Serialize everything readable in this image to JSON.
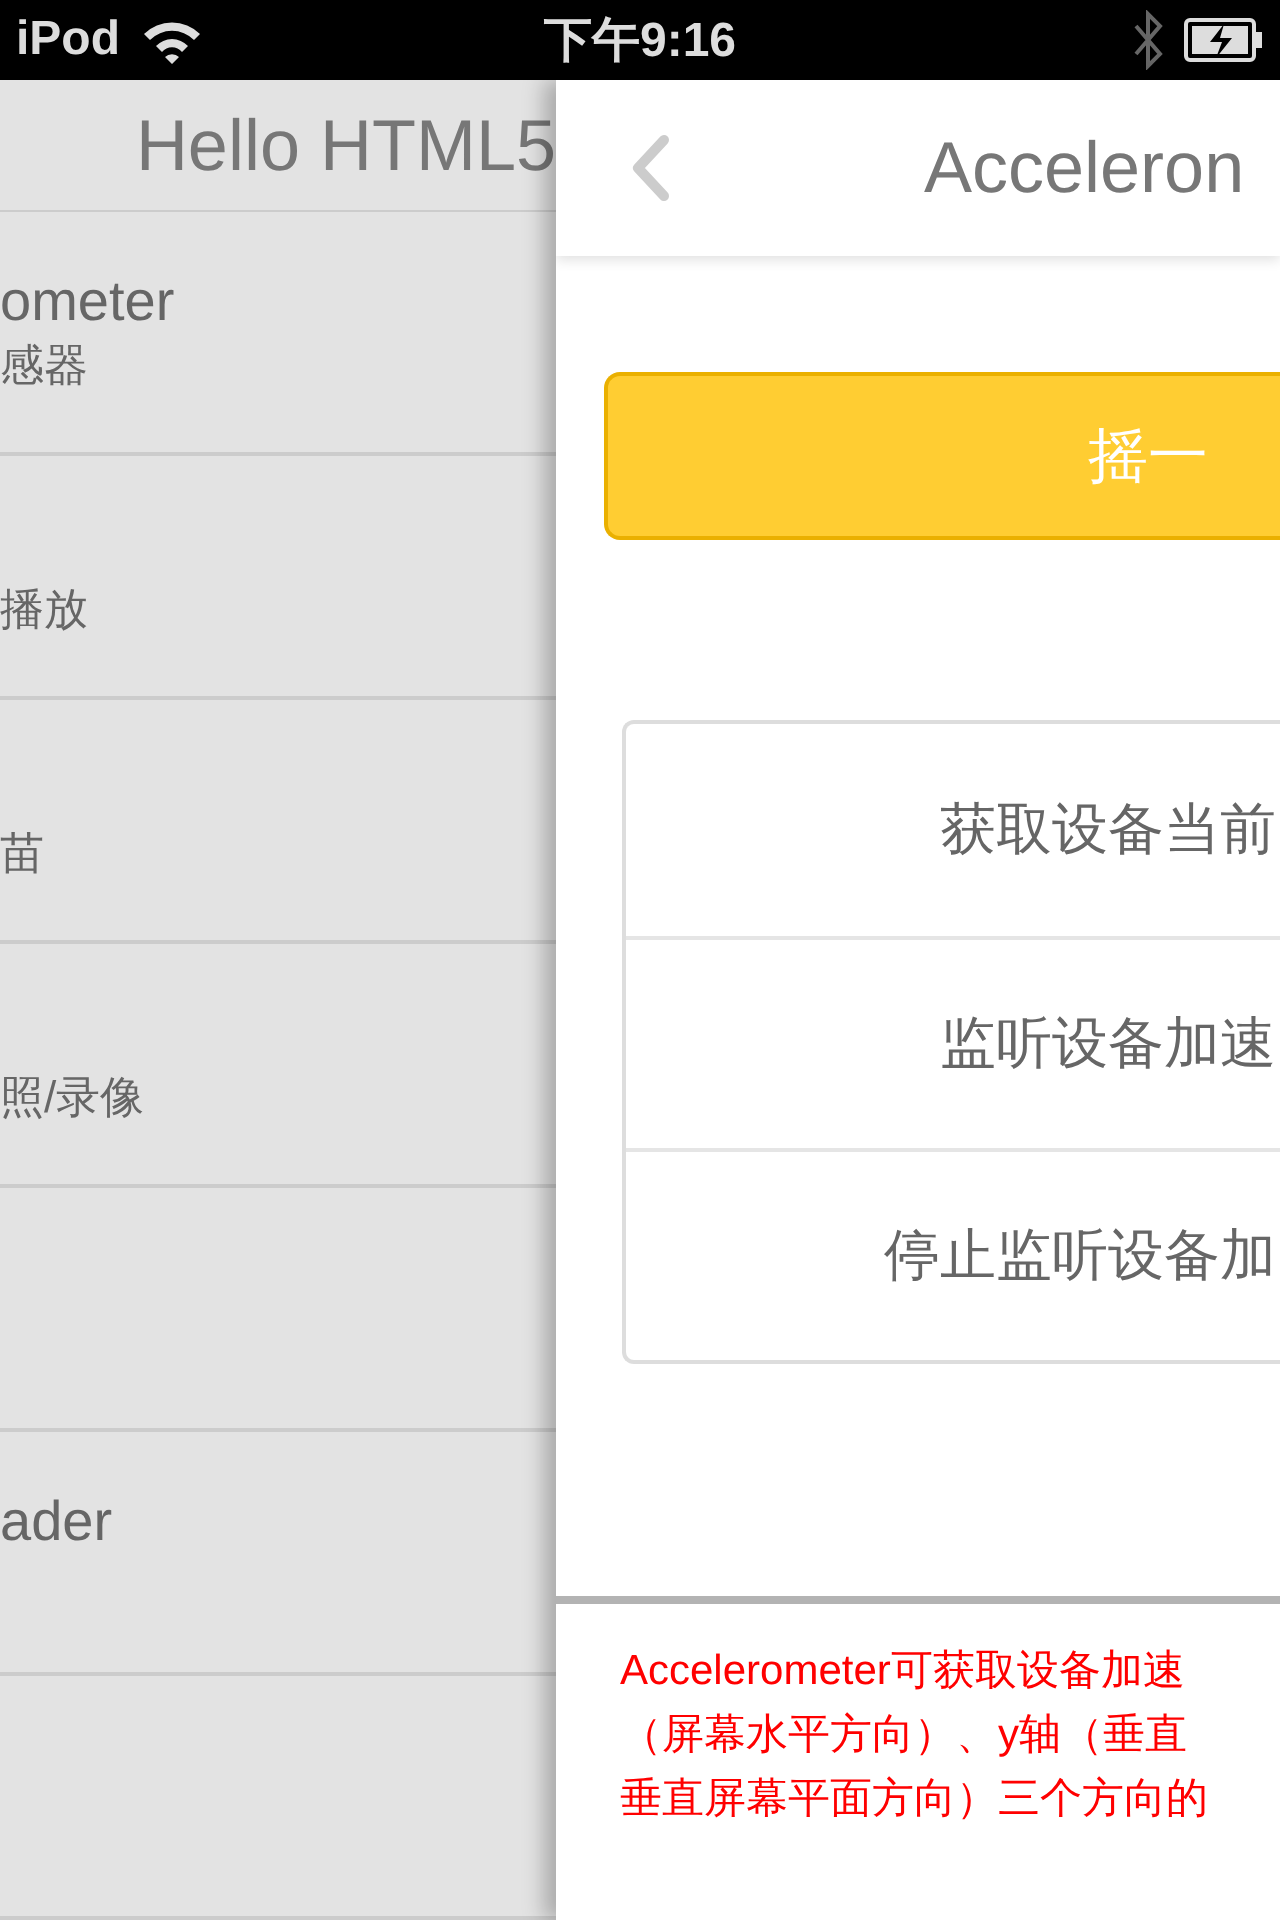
{
  "status_bar": {
    "carrier": "iPod",
    "time": "下午9:16"
  },
  "previous_page": {
    "title": "Hello HTML5",
    "rows": [
      {
        "title": "ometer",
        "subtitle": "感器"
      },
      {
        "subtitle": "播放"
      },
      {
        "subtitle": "苗"
      },
      {
        "subtitle": "照/录像"
      },
      {},
      {
        "title": "ader"
      },
      {}
    ]
  },
  "current_page": {
    "title": "Acceleron",
    "shake_button": "摇一",
    "actions": [
      {
        "label": "获取设备当前"
      },
      {
        "label": "监听设备加速"
      },
      {
        "label": "停止监听设备加"
      }
    ],
    "description_lines": [
      "Accelerometer可获取设备加速",
      "（屏幕水平方向）、y轴（垂直",
      "垂直屏幕平面方向）三个方向的"
    ]
  }
}
